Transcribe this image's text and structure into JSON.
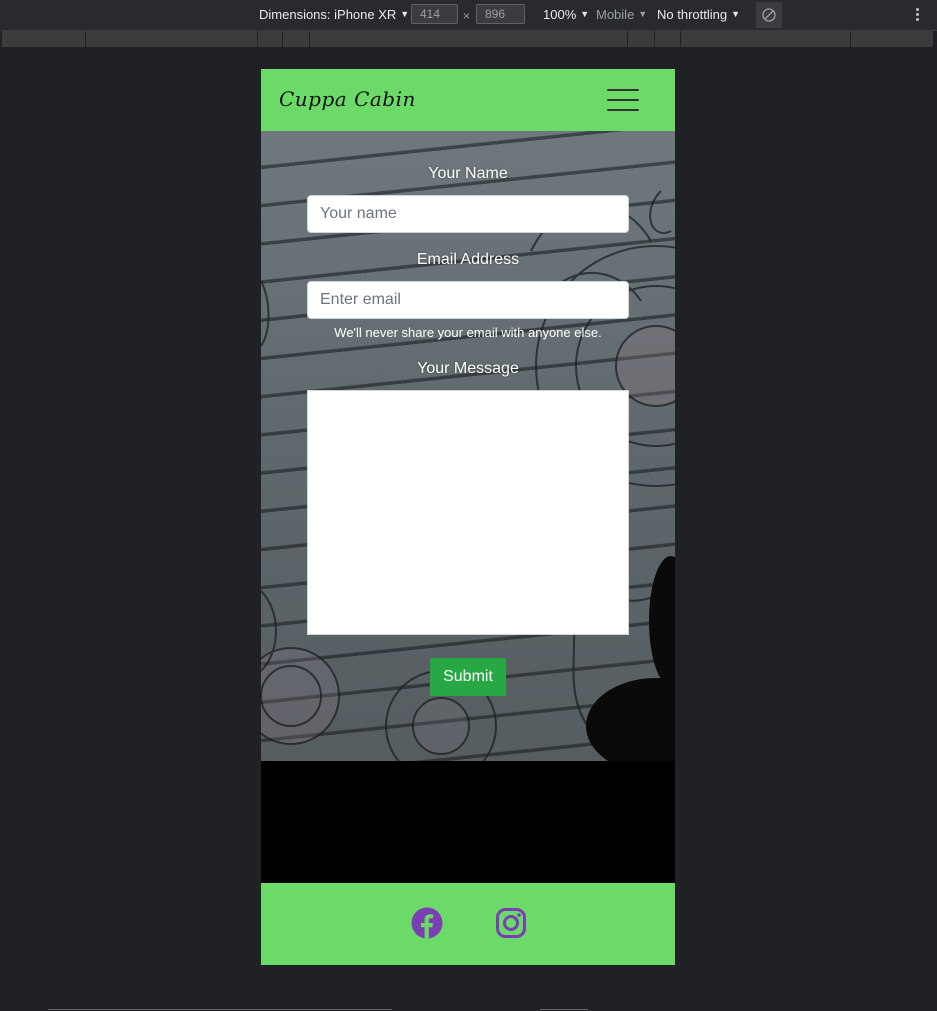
{
  "devtools": {
    "dimensions_label": "Dimensions: iPhone XR",
    "width_value": "414",
    "times_sign": "×",
    "height_value": "896",
    "zoom": "100%",
    "device_type": "Mobile",
    "throttling": "No throttling"
  },
  "site": {
    "brand": "Cuppa Cabin",
    "nav_toggle_icon": "hamburger-menu-icon",
    "accent_color": "#6cda68"
  },
  "form": {
    "name_label": "Your Name",
    "name_placeholder": "Your name",
    "email_label": "Email Address",
    "email_placeholder": "Enter email",
    "email_help": "We'll never share your email with anyone else.",
    "message_label": "Your Message",
    "submit_label": "Submit",
    "submit_color": "#28a745"
  },
  "footer": {
    "icons": [
      "facebook-icon",
      "instagram-icon"
    ],
    "icon_color": "#7a3fb3"
  }
}
